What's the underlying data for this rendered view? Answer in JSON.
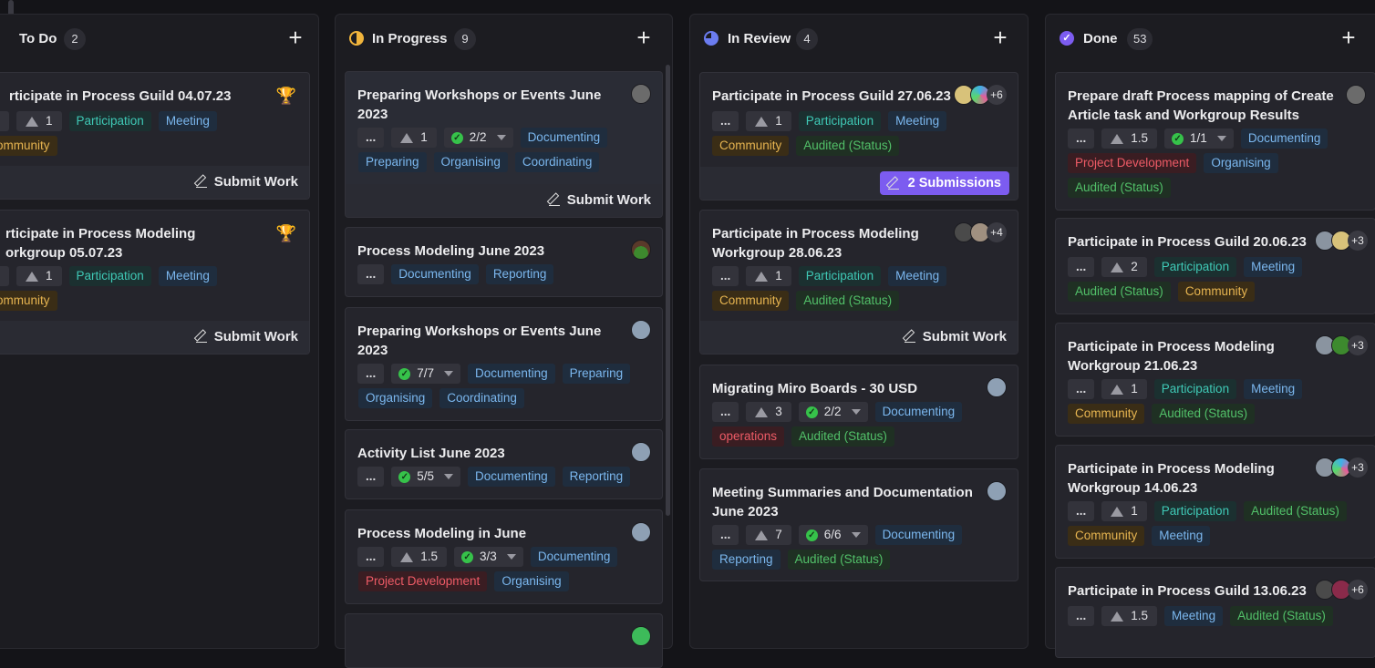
{
  "board": {
    "columns": [
      {
        "id": "todo",
        "title": "To Do",
        "count": "2",
        "cards": [
          {
            "title": "rticipate in Process Guild 04.07.23",
            "points": "1",
            "tags": [
              "Participation",
              "Meeting"
            ],
            "tags2": [
              "ommunity"
            ],
            "action": "Submit Work"
          },
          {
            "title": "rticipate in Process Modeling orkgroup 05.07.23",
            "points": "1",
            "tags": [
              "Participation",
              "Meeting"
            ],
            "tags2": [
              "ommunity"
            ],
            "action": "Submit Work"
          }
        ]
      },
      {
        "id": "inprogress",
        "title": "In Progress",
        "count": "9",
        "cards": [
          {
            "title": "Preparing Workshops or Events June 2023",
            "dots": "...",
            "points": "1",
            "checks": "2/2",
            "tags": [
              "Documenting"
            ],
            "tags2": [
              "Preparing",
              "Organising",
              "Coordinating"
            ],
            "action": "Submit Work"
          },
          {
            "title": "Process Modeling June 2023",
            "dots": "...",
            "tags": [
              "Documenting",
              "Reporting"
            ]
          },
          {
            "title": "Preparing Workshops or Events June 2023",
            "dots": "...",
            "checks": "7/7",
            "tags": [
              "Documenting",
              "Preparing"
            ],
            "tags2": [
              "Organising",
              "Coordinating"
            ]
          },
          {
            "title": "Activity List June 2023",
            "dots": "...",
            "checks": "5/5",
            "tags": [
              "Documenting",
              "Reporting"
            ]
          },
          {
            "title": "Process Modeling in June",
            "dots": "...",
            "points": "1.5",
            "checks": "3/3",
            "tags": [
              "Documenting"
            ],
            "tags2": [
              "Project Development",
              "Organising"
            ]
          }
        ]
      },
      {
        "id": "inreview",
        "title": "In Review",
        "count": "4",
        "cards": [
          {
            "title": "Participate in Process Guild 27.06.23",
            "dots": "...",
            "points": "1",
            "tags": [
              "Participation",
              "Meeting"
            ],
            "tags2": [
              "Community",
              "Audited (Status)"
            ],
            "avatars_more": "+6",
            "action": "2 Submissions"
          },
          {
            "title": "Participate in Process Modeling Workgroup 28.06.23",
            "dots": "...",
            "points": "1",
            "tags": [
              "Participation",
              "Meeting"
            ],
            "tags2": [
              "Community",
              "Audited (Status)"
            ],
            "avatars_more": "+4",
            "action": "Submit Work"
          },
          {
            "title": "Migrating Miro Boards - 30 USD",
            "dots": "...",
            "points": "3",
            "checks": "2/2",
            "tags": [
              "Documenting"
            ],
            "tags2": [
              "operations",
              "Audited (Status)"
            ]
          },
          {
            "title": "Meeting Summaries and Documentation June 2023",
            "dots": "...",
            "points": "7",
            "checks": "6/6",
            "tags": [
              "Documenting"
            ],
            "tags2": [
              "Reporting",
              "Audited (Status)"
            ]
          }
        ]
      },
      {
        "id": "done",
        "title": "Done",
        "count": "53",
        "cards": [
          {
            "title": "Prepare draft Process mapping of Create Article task and Workgroup Results",
            "dots": "...",
            "points": "1.5",
            "checks": "1/1",
            "tags": [
              "Documenting"
            ],
            "tags2": [
              "Project Development",
              "Organising"
            ],
            "tags3": [
              "Audited (Status)"
            ]
          },
          {
            "title": "Participate in Process Guild 20.06.23",
            "dots": "...",
            "points": "2",
            "tags": [
              "Participation",
              "Meeting"
            ],
            "tags2": [
              "Audited (Status)",
              "Community"
            ],
            "avatars_more": "+3"
          },
          {
            "title": "Participate in Process Modeling Workgroup 21.06.23",
            "dots": "...",
            "points": "1",
            "tags": [
              "Participation",
              "Meeting"
            ],
            "tags2": [
              "Community",
              "Audited (Status)"
            ],
            "avatars_more": "+3"
          },
          {
            "title": "Participate in Process Modeling Workgroup 14.06.23",
            "dots": "...",
            "points": "1",
            "tags": [
              "Participation",
              "Audited (Status)"
            ],
            "tags2": [
              "Community",
              "Meeting"
            ],
            "avatars_more": "+3"
          },
          {
            "title": "Participate in Process Guild 13.06.23",
            "dots": "...",
            "points": "1.5",
            "tags": [
              "Meeting",
              "Audited (Status)"
            ],
            "avatars_more": "+6"
          }
        ]
      }
    ],
    "add_label": "+"
  },
  "colors": {
    "in_progress_icon": "#f0b43c",
    "in_review_icon": "#6b7cf0",
    "done_icon": "#7c5cf0",
    "submissions_button": "#7c5cf0"
  }
}
